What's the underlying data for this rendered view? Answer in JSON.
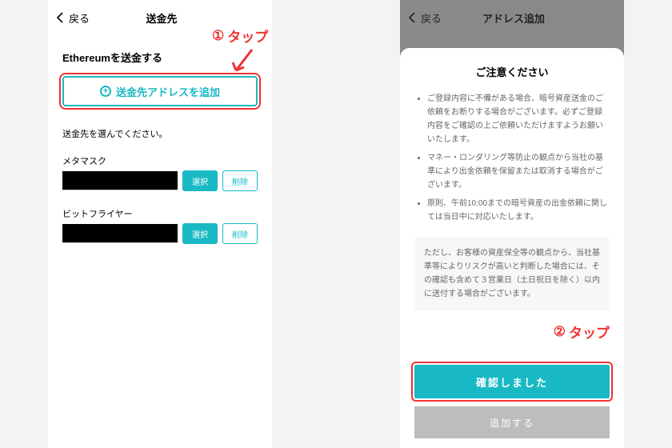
{
  "annotations": {
    "step1": {
      "num": "①",
      "label": "タップ"
    },
    "step2": {
      "num": "②",
      "label": "タップ"
    }
  },
  "left": {
    "back": "戻る",
    "header_title": "送金先",
    "page_title": "Ethereumを送金する",
    "add_button": "送金先アドレスを追加",
    "hint": "送金先を選んでください。",
    "select_label": "選択",
    "delete_label": "削除",
    "addresses": [
      {
        "name": "メタマスク"
      },
      {
        "name": "ビットフライヤー"
      }
    ]
  },
  "right": {
    "back": "戻る",
    "header_title": "アドレス追加",
    "modal": {
      "title": "ご注意ください",
      "bullets": [
        "ご登録内容に不備がある場合、暗号資産送金のご依頼をお断りする場合がございます。必ずご登録内容をご確認の上ご依頼いただけますようお願いいたします。",
        "マネー・ロンダリング等防止の観点から当社の基準により出金依頼を保留または取消する場合がございます。",
        "原則、午前10:00までの暗号資産の出金依頼に関しては当日中に対応いたします。"
      ],
      "note": "ただし、お客様の資産保全等の観点から、当社基準等によりリスクが高いと判断した場合には、その確認も含めて３営業日（土日祝日を除く）以内に送付する場合がございます。",
      "confirm": "確認しました"
    },
    "bottom_button": "追加する"
  }
}
